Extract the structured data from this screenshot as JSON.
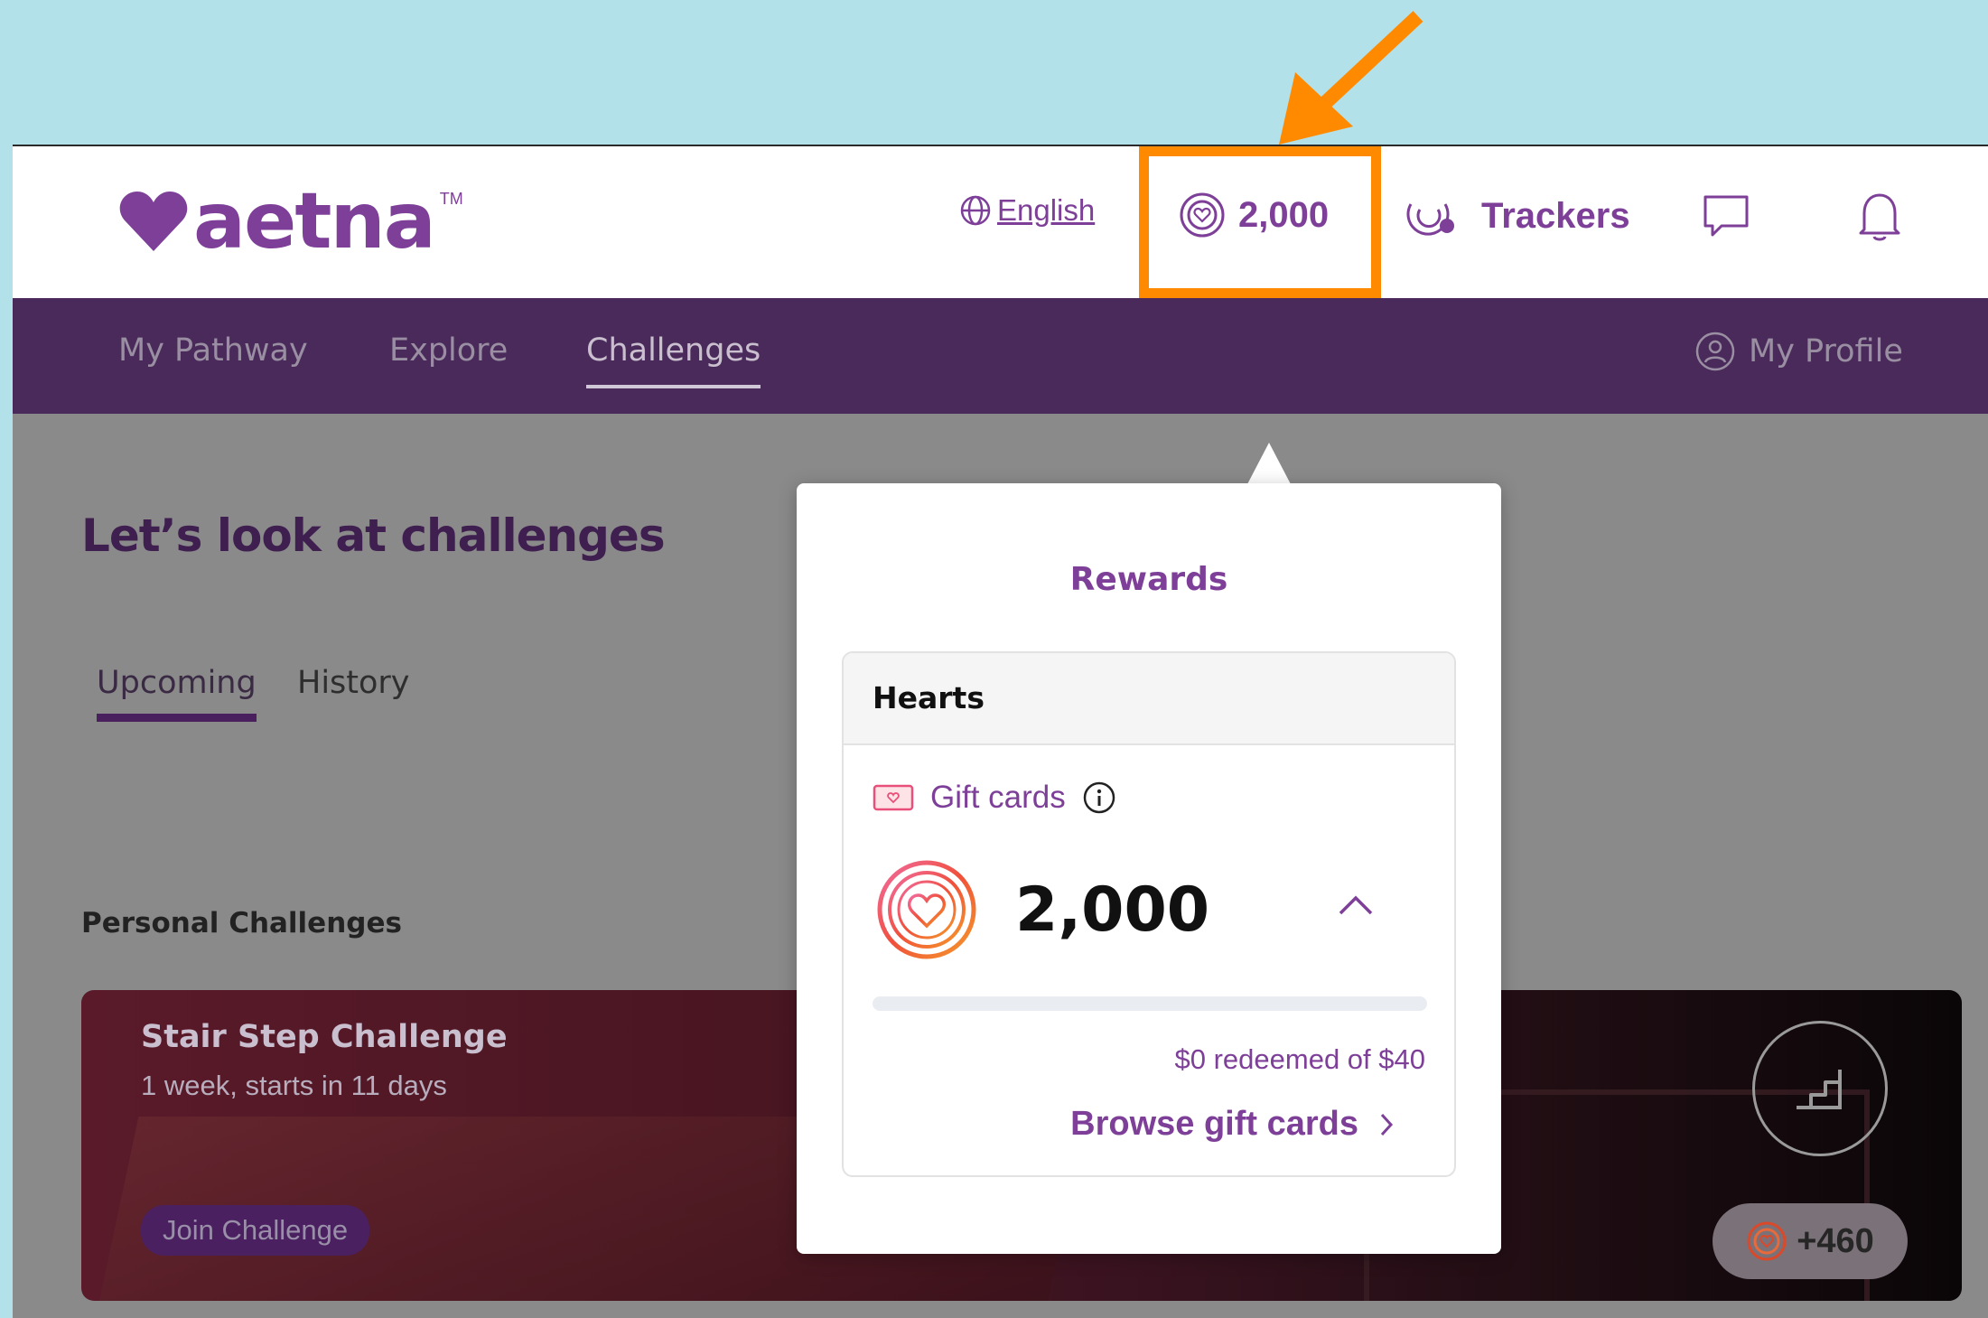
{
  "brand": {
    "logo_text": "aetna",
    "trademark": "TM",
    "color": "#7d3f98"
  },
  "header": {
    "language_label": "English",
    "points_value": "2,000",
    "trackers_label": "Trackers"
  },
  "nav": {
    "items": [
      {
        "label": "My Pathway"
      },
      {
        "label": "Explore"
      },
      {
        "label": "Challenges",
        "active": true
      }
    ],
    "profile_label": "My Profile"
  },
  "page": {
    "title": "Let’s look at challenges",
    "tabs": [
      {
        "label": "Upcoming",
        "active": true
      },
      {
        "label": "History"
      }
    ],
    "section_title": "Personal Challenges"
  },
  "challenge_card": {
    "title": "Stair Step Challenge",
    "subtitle": "1 week, starts in 11 days",
    "join_label": "Join Challenge",
    "bonus": "+460"
  },
  "rewards_popup": {
    "title": "Rewards",
    "hearts_header": "Hearts",
    "gift_cards_label": "Gift cards",
    "balance": "2,000",
    "progress_fraction": 0,
    "redeemed_text": "$0 redeemed of $40",
    "browse_label": "Browse gift cards"
  },
  "annotation": {
    "highlight_color": "#ff8a00"
  }
}
